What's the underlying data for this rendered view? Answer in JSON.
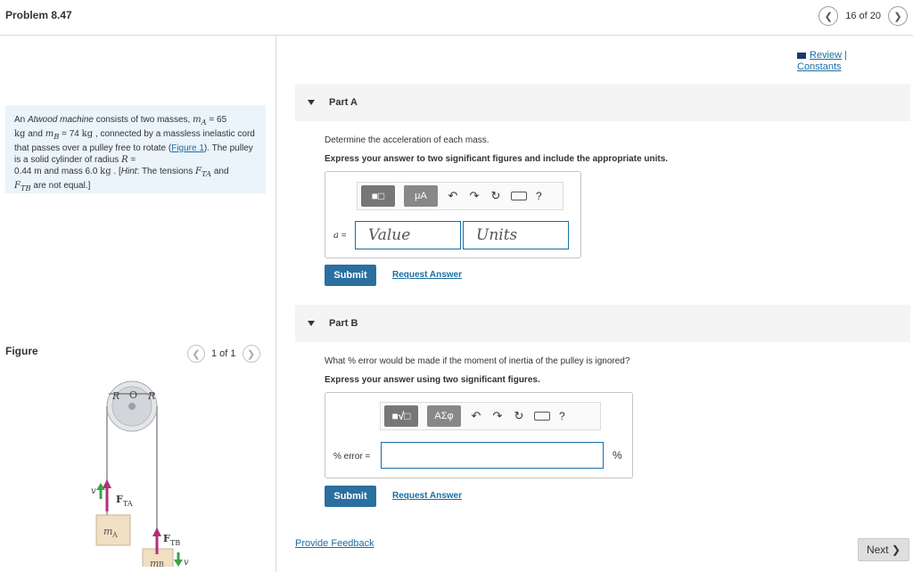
{
  "header": {
    "title": "Problem 8.47",
    "page_count": "16 of 20",
    "prev_icon": "chevron-left",
    "next_icon": "chevron-right"
  },
  "problem": {
    "t1": "An ",
    "t2": "Atwood machine",
    "t3": " consists of two masses, ",
    "mA_sym": "m",
    "mA_sub": "A",
    "t4": " = 65",
    "t5": "kg",
    "t6": " and ",
    "mB_sym": "m",
    "mB_sub": "B",
    "t7": " = 74 ",
    "t8": "kg",
    "t9": " , connected by a massless inelastic cord that passes over a pulley free to rotate (",
    "figlink": "Figure 1",
    "t10": "). The pulley is a solid cylinder of radius ",
    "R_sym": "R",
    "t11": " =",
    "t12": "0.44 m",
    "t13": " and mass 6.0 ",
    "t14": "kg",
    "t15": " . [",
    "hint": "Hint",
    "t16": ": The tensions ",
    "FTA_sym": "F",
    "FTA_sub": "TA",
    "t17": " and ",
    "FTB_sym": "F",
    "FTB_sub": "TB",
    "t18": " are not equal.]"
  },
  "figure": {
    "label": "Figure",
    "page_count": "1 of 1",
    "labels": {
      "R1": "R",
      "O": "O",
      "R2": "R",
      "v1": "v",
      "FTA": "F",
      "FTA_sub": "TA",
      "mA": "m",
      "mA_sub": "A",
      "FTB": "F",
      "FTB_sub": "TB",
      "mB": "m",
      "mB_sub": "B",
      "v2": "v"
    }
  },
  "review": {
    "line1": "Review",
    "sep": " |",
    "line2": "Constants"
  },
  "partA": {
    "title": "Part A",
    "question": "Determine the acceleration of each mass.",
    "instruction": "Express your answer to two significant figures and include the appropriate units.",
    "toolbar_greek": "μA",
    "var_label": "a",
    "eq": " =",
    "value_placeholder": "Value",
    "units_placeholder": "Units",
    "submit": "Submit",
    "request": "Request Answer"
  },
  "partB": {
    "title": "Part B",
    "question": "What % error would be made if the moment of inertia of the pulley is ignored?",
    "instruction": "Express your answer using two significant figures.",
    "toolbar_greek": "ΑΣφ",
    "label": "% error =",
    "unit": "%",
    "submit": "Submit",
    "request": "Request Answer"
  },
  "footer": {
    "feedback": "Provide Feedback",
    "next": "Next"
  },
  "toolbar_glyphs": {
    "help": "?"
  },
  "colors": {
    "accent": "#2a6fa0",
    "link": "#1a6ea3",
    "problem_bg": "#eaf4fa",
    "arrow_green": "#3aa34a",
    "arrow_magenta": "#b0307a"
  }
}
